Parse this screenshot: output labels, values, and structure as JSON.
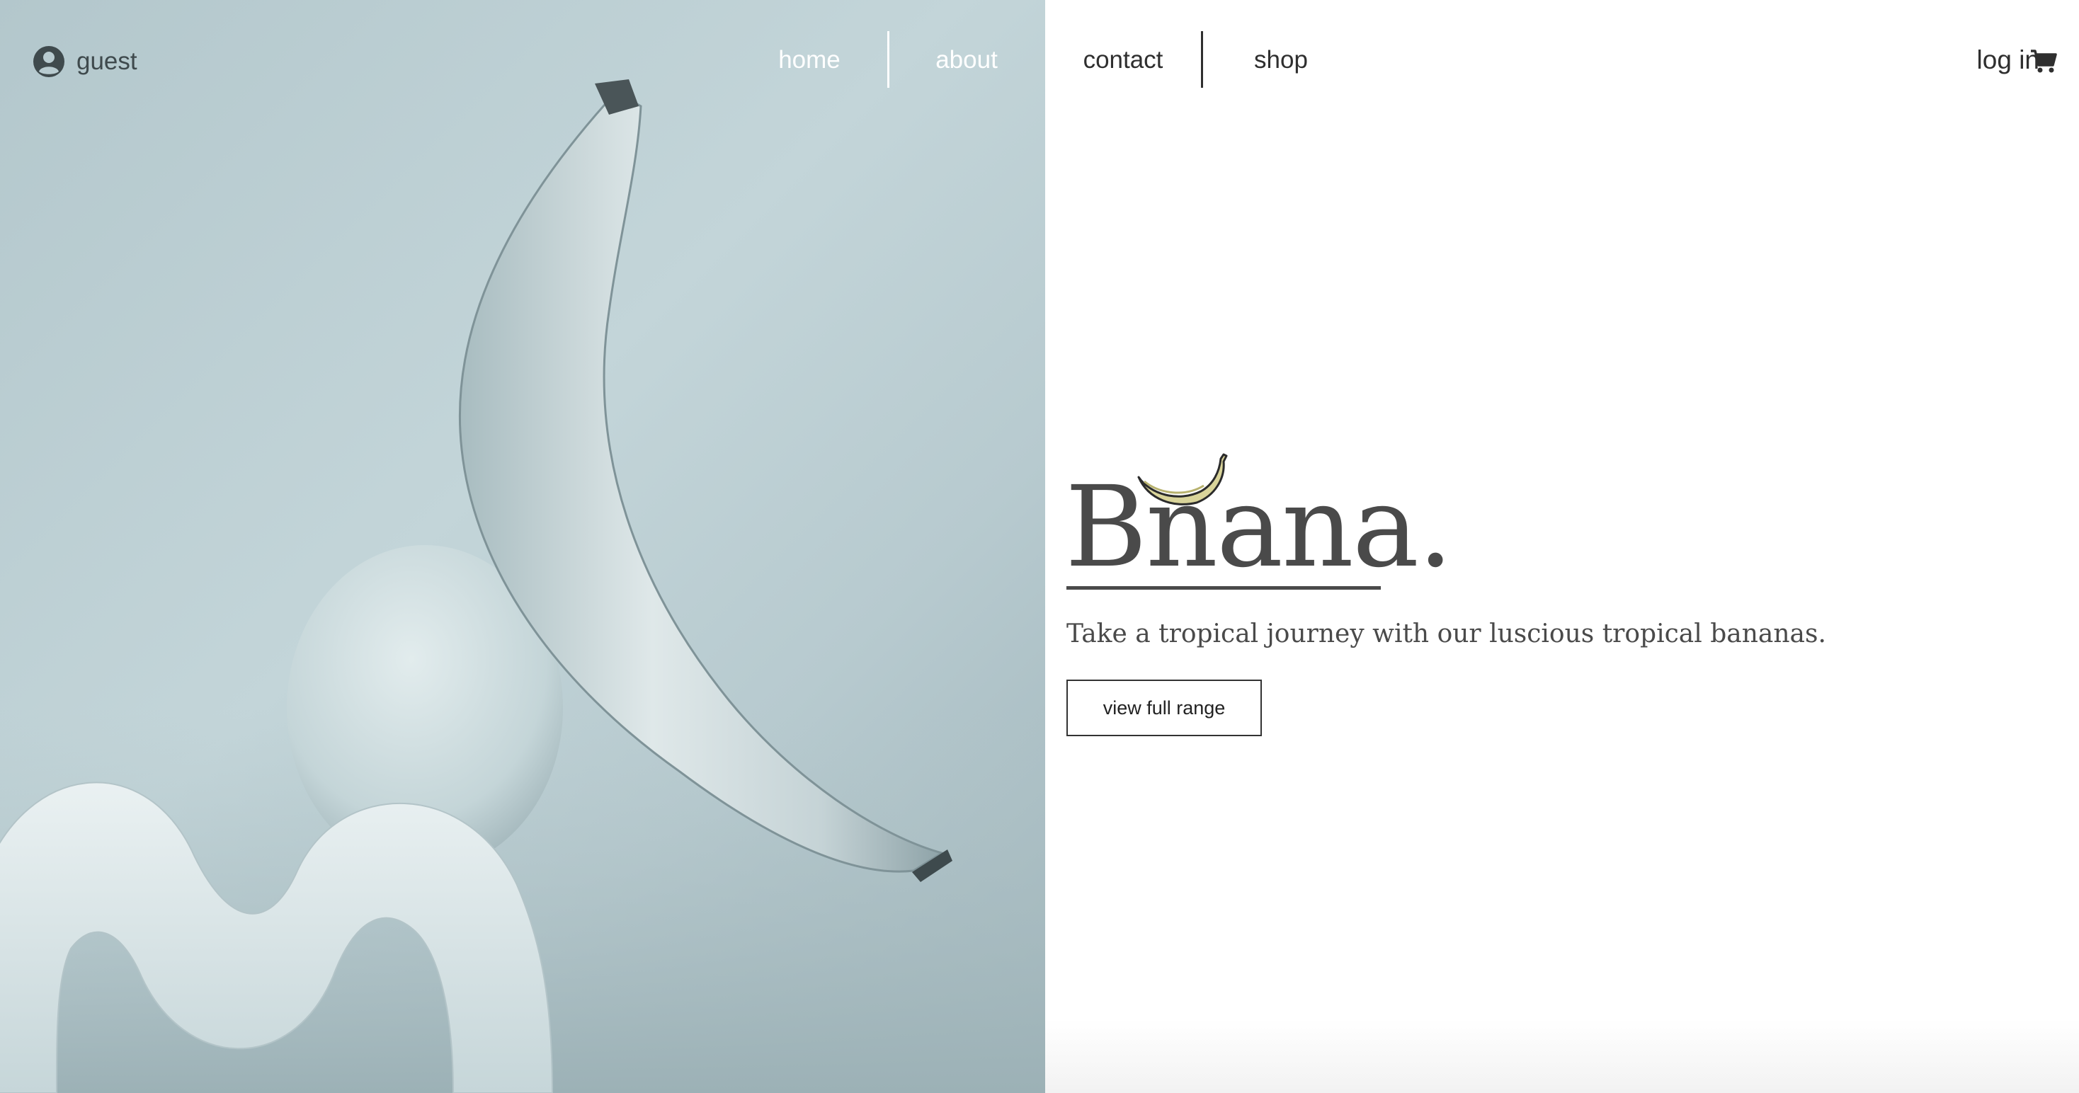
{
  "user": {
    "name": "guest",
    "avatar_icon": "user-circle-icon"
  },
  "nav": {
    "home": "home",
    "about": "about",
    "contact": "contact",
    "shop": "shop"
  },
  "account": {
    "login": "log in",
    "cart_icon": "shopping-cart-icon"
  },
  "hero": {
    "brand": "Bnana.",
    "brand_icon": "banana-icon",
    "tagline": "Take a tropical journey with our luscious tropical bananas.",
    "cta": "view full range",
    "photo_subject": "banana-still-life-photo"
  },
  "colors": {
    "photo_tint": "#b8cbd0",
    "text_dark": "#4a4a4a",
    "banana_icon": "#d9d49a",
    "nav_light": "#ffffff"
  }
}
